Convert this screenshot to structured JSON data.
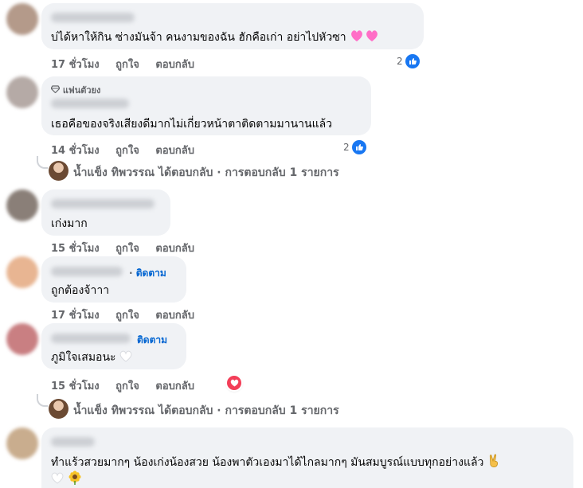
{
  "comments": [
    {
      "text": "บ่ได้หาให้กิน ซ่างมันจ้า คนงามของฉัน ฮักคือเก่า อย่าไปหัวซา",
      "time": "17 ชั่วโมง",
      "like_label": "ถูกใจ",
      "reply_label": "ตอบกลับ",
      "reaction_count": "2",
      "avatar_color": "#b49a8a"
    },
    {
      "badge": "แฟนตัวยง",
      "text": "เธอคือของจริงเสียงดีมากไม่เกี่ยวหน้าตาติดตามมานานแล้ว",
      "time": "14 ชั่วโมง",
      "like_label": "ถูกใจ",
      "reply_label": "ตอบกลับ",
      "reaction_count": "2",
      "avatar_color": "#b5aaa6"
    },
    {
      "text": "เก่งมาก",
      "time": "15 ชั่วโมง",
      "like_label": "ถูกใจ",
      "reply_label": "ตอบกลับ",
      "avatar_color": "#8a7f78"
    },
    {
      "follow_label": "ติดตาม",
      "text": "ถูกต้องจ้าาา",
      "time": "17 ชั่วโมง",
      "like_label": "ถูกใจ",
      "reply_label": "ตอบกลับ",
      "avatar_color": "#e8b592"
    },
    {
      "follow_label": "ติดตาม",
      "text": "ภูมิใจเสมอนะ",
      "time": "15 ชั่วโมง",
      "like_label": "ถูกใจ",
      "reply_label": "ตอบกลับ",
      "avatar_color": "#c97f82"
    },
    {
      "text": "ทำแร้วสวยมากๆ น้องเก่งน้องสวย น้องพาตัวเองมาได้ไกลมากๆ มันสมบูรณ์แบบทุกอย่างแล้ว",
      "avatar_color": "#c9ad8e"
    }
  ],
  "replies": [
    {
      "author": "น้ำแข็ง ทิพวรรณ",
      "text": "ได้ตอบกลับ · การตอบกลับ 1 รายการ"
    },
    {
      "author": "น้ำแข็ง ทิพวรรณ",
      "text": "ได้ตอบกลับ · การตอบกลับ 1 รายการ"
    }
  ],
  "colors": {
    "bubble": "#f0f2f5",
    "link": "#0064d1",
    "like": "#1877f2",
    "love": "#f33e58",
    "meta": "#65676b"
  }
}
